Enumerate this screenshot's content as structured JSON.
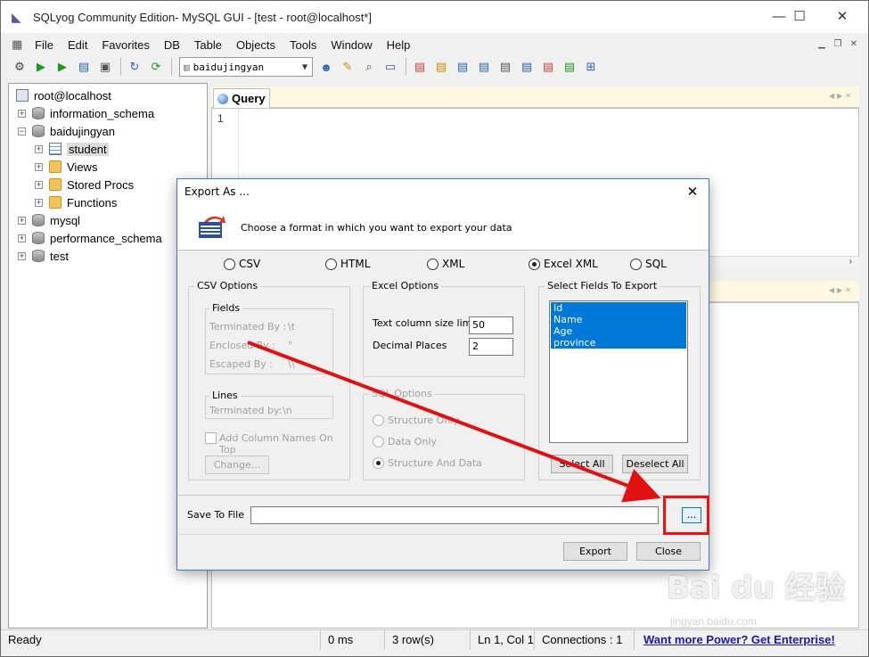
{
  "window": {
    "title": "SQLyog Community Edition- MySQL GUI - [test - root@localhost*]",
    "controls": {
      "minimize": "—",
      "maximize": "☐",
      "close": "✕"
    }
  },
  "menu": [
    "File",
    "Edit",
    "Favorites",
    "DB",
    "Table",
    "Objects",
    "Tools",
    "Window",
    "Help"
  ],
  "toolbar": {
    "database_selected": "baidujingyan"
  },
  "object_browser": {
    "items": [
      {
        "label": "root@localhost",
        "type": "server",
        "level": 0
      },
      {
        "label": "information_schema",
        "type": "db",
        "level": 0,
        "expander": "+"
      },
      {
        "label": "baidujingyan",
        "type": "db",
        "level": 0,
        "expander": "−"
      },
      {
        "label": "student",
        "type": "table",
        "level": 1,
        "expander": "+",
        "selected": true
      },
      {
        "label": "Views",
        "type": "folder",
        "level": 1,
        "expander": "+"
      },
      {
        "label": "Stored Procs",
        "type": "folder",
        "level": 1,
        "expander": "+"
      },
      {
        "label": "Functions",
        "type": "folder",
        "level": 1,
        "expander": "+"
      },
      {
        "label": "mysql",
        "type": "db",
        "level": 0,
        "expander": "+"
      },
      {
        "label": "performance_schema",
        "type": "db",
        "level": 0,
        "expander": "+"
      },
      {
        "label": "test",
        "type": "db",
        "level": 0,
        "expander": "+"
      }
    ]
  },
  "query_tab": {
    "label": "Query",
    "line_number": "1"
  },
  "dialog": {
    "title": "Export As ...",
    "header_text": "Choose a format in which you want to export your data",
    "formats": [
      {
        "label": "CSV",
        "checked": false
      },
      {
        "label": "HTML",
        "checked": false
      },
      {
        "label": "XML",
        "checked": false
      },
      {
        "label": "Excel XML",
        "checked": true
      },
      {
        "label": "SQL",
        "checked": false
      }
    ],
    "csv_options": {
      "title": "CSV Options",
      "fields_title": "Fields",
      "terminated_by_label": "Terminated By :",
      "terminated_by_value": "\\t",
      "enclosed_by_label": "Enclosed By :",
      "enclosed_by_value": "\"",
      "escaped_by_label": "Escaped By :",
      "escaped_by_value": "\\\\",
      "lines_title": "Lines",
      "lines_terminated_label": "Terminated by:",
      "lines_terminated_value": "\\n",
      "add_column_names_label": "Add Column Names On Top",
      "change_button": "Change..."
    },
    "excel_options": {
      "title": "Excel Options",
      "text_col_size_label": "Text column size limit",
      "text_col_size_value": "50",
      "decimal_places_label": "Decimal Places",
      "decimal_places_value": "2"
    },
    "sql_options": {
      "title": "SQL Options",
      "items": [
        "Structure Only",
        "Data Only",
        "Structure And Data"
      ]
    },
    "select_fields": {
      "title": "Select Fields To Export",
      "fields": [
        "Id",
        "Name",
        "Age",
        "province"
      ],
      "select_all": "Select All",
      "deselect_all": "Deselect All"
    },
    "save_to_file_label": "Save To File",
    "save_to_file_value": "",
    "browse_button": "...",
    "export_button": "Export",
    "close_button": "Close"
  },
  "statusbar": {
    "state": "Ready",
    "time": "0 ms",
    "rows": "3 row(s)",
    "position": "Ln 1, Col 1",
    "connections": "Connections : 1",
    "promo": "Want more Power? Get Enterprise!"
  },
  "watermark": {
    "main": "Bai du 经验",
    "sub": "jingyan.baidu.com"
  },
  "colors": {
    "annotation": "#e11111",
    "selection": "#0078d7",
    "promo_link": "#1a1aa6"
  }
}
